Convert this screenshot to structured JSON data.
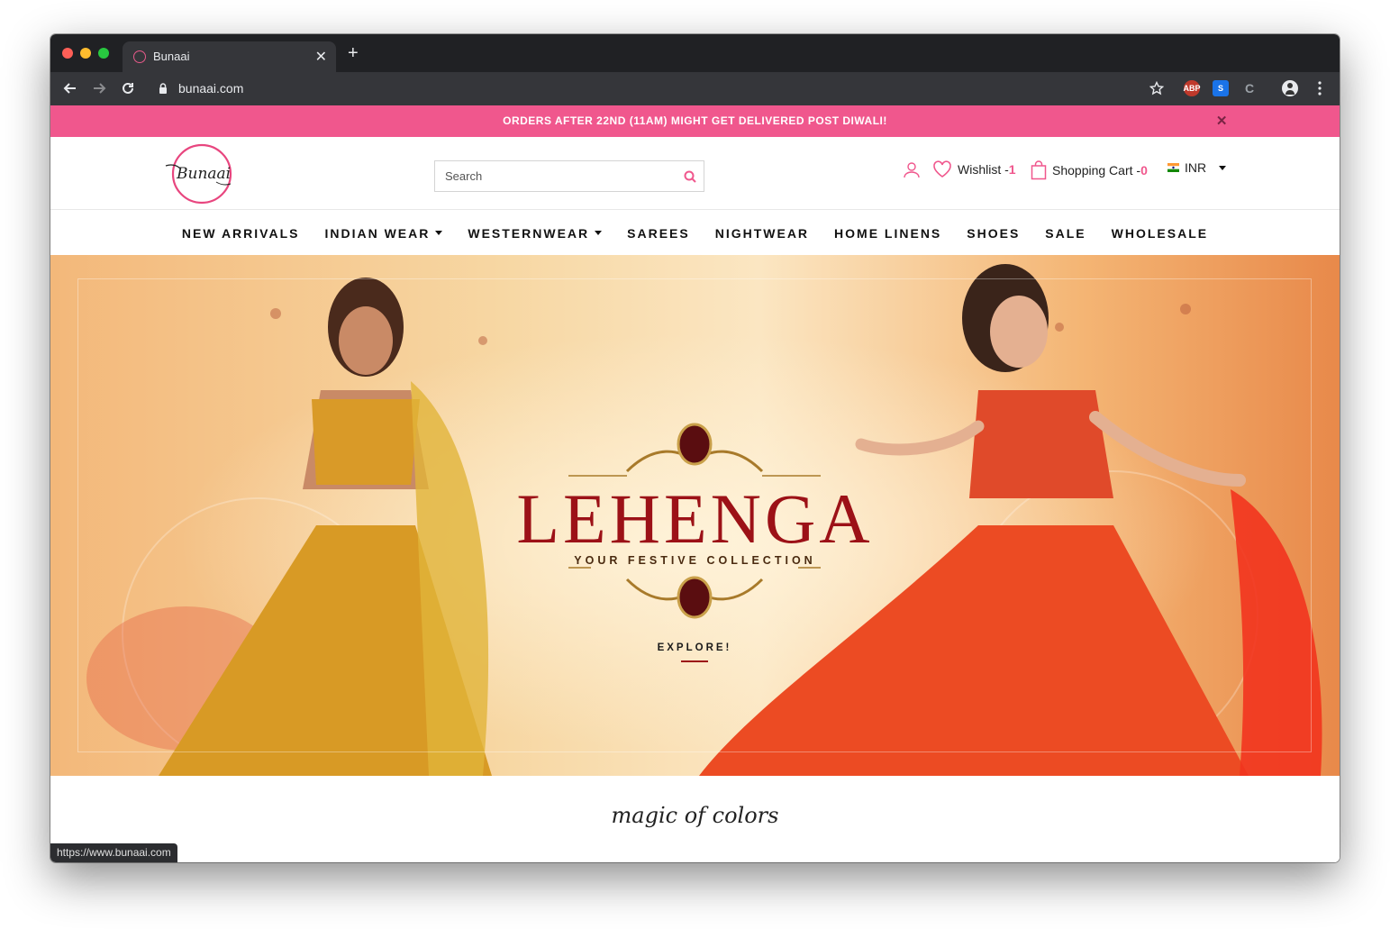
{
  "browser": {
    "tab_title": "Bunaai",
    "url": "bunaai.com",
    "new_tab": "+",
    "close_tab": "✕",
    "status_url": "https://www.bunaai.com"
  },
  "promo": {
    "text": "ORDERS AFTER 22ND (11AM) MIGHT GET DELIVERED POST DIWALI!",
    "close": "✕"
  },
  "header": {
    "logo_text": "Bunaai",
    "search_placeholder": "Search",
    "wishlist_label": "Wishlist -",
    "wishlist_count": "1",
    "cart_label": "Shopping Cart -",
    "cart_count": "0",
    "currency": "INR"
  },
  "nav": [
    {
      "label": "NEW ARRIVALS",
      "dropdown": false
    },
    {
      "label": "INDIAN WEAR",
      "dropdown": true
    },
    {
      "label": "WESTERNWEAR",
      "dropdown": true
    },
    {
      "label": "SAREES",
      "dropdown": false
    },
    {
      "label": "NIGHTWEAR",
      "dropdown": false
    },
    {
      "label": "HOME LINENS",
      "dropdown": false
    },
    {
      "label": "SHOES",
      "dropdown": false
    },
    {
      "label": "SALE",
      "dropdown": false
    },
    {
      "label": "WHOLESALE",
      "dropdown": false
    }
  ],
  "hero": {
    "title": "LEHENGA",
    "subtitle": "YOUR FESTIVE COLLECTION",
    "cta": "EXPLORE!"
  },
  "section": {
    "title": "magic of colors"
  },
  "colors": {
    "brand_pink": "#f0578d",
    "hero_title": "#9c1117",
    "chrome_dark": "#202124"
  }
}
